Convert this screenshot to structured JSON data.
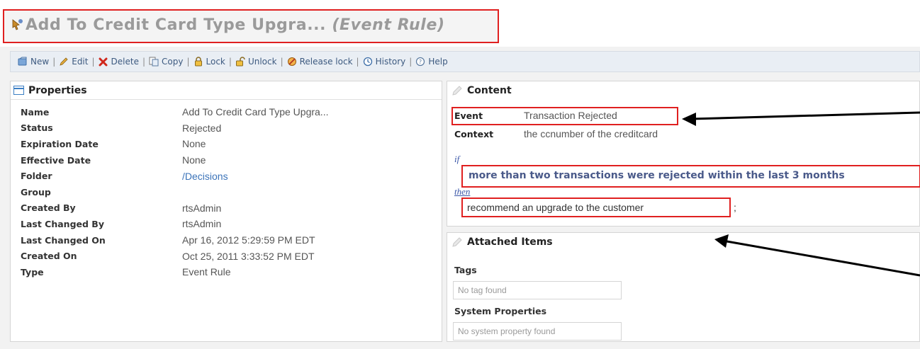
{
  "header": {
    "rule_name": "Add To Credit Card Type Upgra...",
    "rule_type": "(Event Rule)"
  },
  "toolbar": {
    "items": [
      {
        "label": "New",
        "icon": "new-icon"
      },
      {
        "label": "Edit",
        "icon": "edit-icon"
      },
      {
        "label": "Delete",
        "icon": "delete-icon"
      },
      {
        "label": "Copy",
        "icon": "copy-icon"
      },
      {
        "label": "Lock",
        "icon": "lock-icon"
      },
      {
        "label": "Unlock",
        "icon": "unlock-icon"
      },
      {
        "label": "Release lock",
        "icon": "release-lock-icon"
      },
      {
        "label": "History",
        "icon": "history-icon"
      },
      {
        "label": "Help",
        "icon": "help-icon"
      }
    ]
  },
  "properties": {
    "title": "Properties",
    "rows": [
      {
        "key": "Name",
        "value": "Add To Credit Card Type Upgra..."
      },
      {
        "key": "Status",
        "value": "Rejected"
      },
      {
        "key": "Expiration Date",
        "value": "None"
      },
      {
        "key": "Effective Date",
        "value": "None"
      },
      {
        "key": "Folder",
        "value": "/Decisions"
      },
      {
        "key": "Group",
        "value": ""
      },
      {
        "key": "Created By",
        "value": "rtsAdmin"
      },
      {
        "key": "Last Changed By",
        "value": "rtsAdmin"
      },
      {
        "key": "Last Changed On",
        "value": "Apr 16, 2012 5:29:59 PM EDT"
      },
      {
        "key": "Created On",
        "value": "Oct 25, 2011 3:33:52 PM EDT"
      },
      {
        "key": "Type",
        "value": "Event Rule"
      }
    ]
  },
  "content": {
    "title": "Content",
    "event_label": "Event",
    "event_value": "Transaction Rejected",
    "context_label": "Context",
    "context_value": "the ccnumber of the creditcard",
    "if_keyword": "if",
    "condition": "more than two transactions were rejected within the last 3 months",
    "then_keyword": "then",
    "action": "recommend an upgrade to the customer",
    "action_end": ";"
  },
  "attached": {
    "title": "Attached Items",
    "tags_label": "Tags",
    "tags_empty": "No tag found",
    "system_label": "System Properties",
    "system_empty": "No system property found"
  },
  "colors": {
    "highlight_border": "#e02020",
    "link": "#3b73b9",
    "toolbar_bg": "#e9eef4"
  }
}
